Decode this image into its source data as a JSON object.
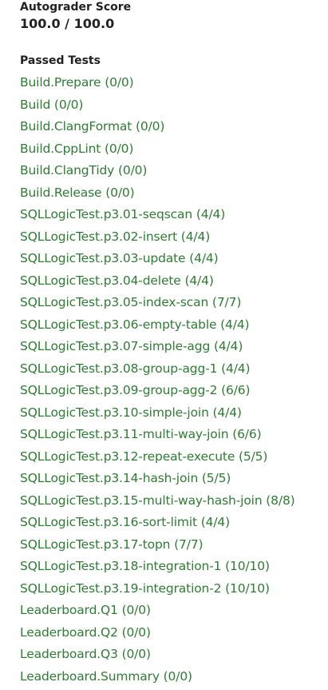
{
  "score": {
    "heading": "Autograder Score",
    "value": "100.0 / 100.0"
  },
  "passed_tests": {
    "heading": "Passed Tests",
    "items": [
      "Build.Prepare (0/0)",
      "Build (0/0)",
      "Build.ClangFormat (0/0)",
      "Build.CppLint (0/0)",
      "Build.ClangTidy (0/0)",
      "Build.Release (0/0)",
      "SQLLogicTest.p3.01-seqscan (4/4)",
      "SQLLogicTest.p3.02-insert (4/4)",
      "SQLLogicTest.p3.03-update (4/4)",
      "SQLLogicTest.p3.04-delete (4/4)",
      "SQLLogicTest.p3.05-index-scan (7/7)",
      "SQLLogicTest.p3.06-empty-table (4/4)",
      "SQLLogicTest.p3.07-simple-agg (4/4)",
      "SQLLogicTest.p3.08-group-agg-1 (4/4)",
      "SQLLogicTest.p3.09-group-agg-2 (6/6)",
      "SQLLogicTest.p3.10-simple-join (4/4)",
      "SQLLogicTest.p3.11-multi-way-join (6/6)",
      "SQLLogicTest.p3.12-repeat-execute (5/5)",
      "SQLLogicTest.p3.14-hash-join (5/5)",
      "SQLLogicTest.p3.15-multi-way-hash-join (8/8)",
      "SQLLogicTest.p3.16-sort-limit (4/4)",
      "SQLLogicTest.p3.17-topn (7/7)",
      "SQLLogicTest.p3.18-integration-1 (10/10)",
      "SQLLogicTest.p3.19-integration-2 (10/10)",
      "Leaderboard.Q1 (0/0)",
      "Leaderboard.Q2 (0/0)",
      "Leaderboard.Q3 (0/0)",
      "Leaderboard.Summary (0/0)"
    ]
  },
  "colors": {
    "link": "#2e7d32",
    "heading": "#222222",
    "background": "#ffffff"
  }
}
